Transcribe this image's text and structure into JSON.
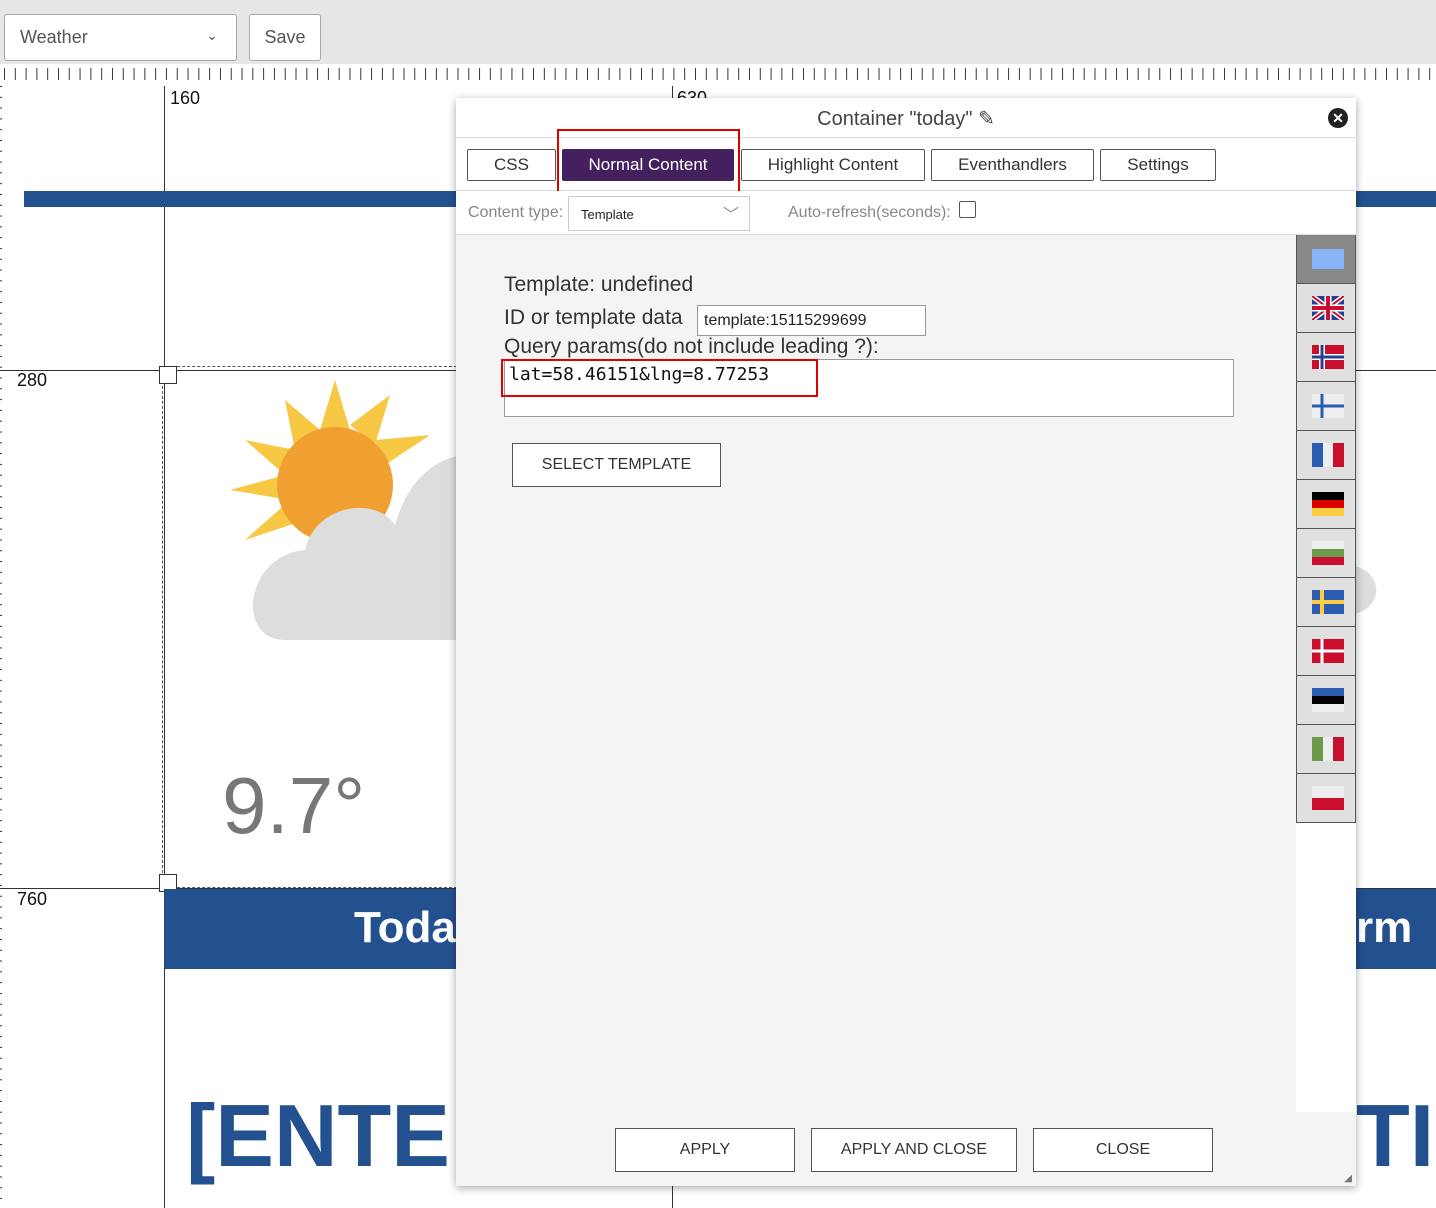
{
  "toolbar": {
    "dashboard_select": "Weather",
    "save_label": "Save"
  },
  "ruler": {
    "top_labels": [
      "160",
      "630"
    ],
    "left_labels": [
      "280",
      "760"
    ]
  },
  "canvas": {
    "temperature": "9.7°",
    "banner_left": "Toda",
    "banner_right": "rm",
    "big_left": "[ENTE",
    "big_right": "TI",
    "accent": "#23508f"
  },
  "dialog": {
    "title": "Container \"today\"",
    "tabs": [
      {
        "label": "CSS"
      },
      {
        "label": "Normal Content",
        "active": true
      },
      {
        "label": "Highlight Content"
      },
      {
        "label": "Eventhandlers"
      },
      {
        "label": "Settings"
      }
    ],
    "content_type_label": "Content type:",
    "content_type_value": "Template",
    "autorefresh_label": "Auto-refresh(seconds):",
    "autorefresh_checked": false,
    "template_label": "Template: undefined",
    "id_label": "ID or template data",
    "id_value": "template:15115299699",
    "query_label": "Query params(do not include leading ?):",
    "query_value": "lat=58.46151&lng=8.77253",
    "select_template": "SELECT TEMPLATE",
    "apply": "APPLY",
    "apply_close": "APPLY AND CLOSE",
    "close": "CLOSE",
    "languages": [
      "un",
      "gb",
      "no",
      "fi",
      "fr",
      "de",
      "bg",
      "se",
      "dk",
      "ee",
      "it",
      "pl"
    ]
  }
}
